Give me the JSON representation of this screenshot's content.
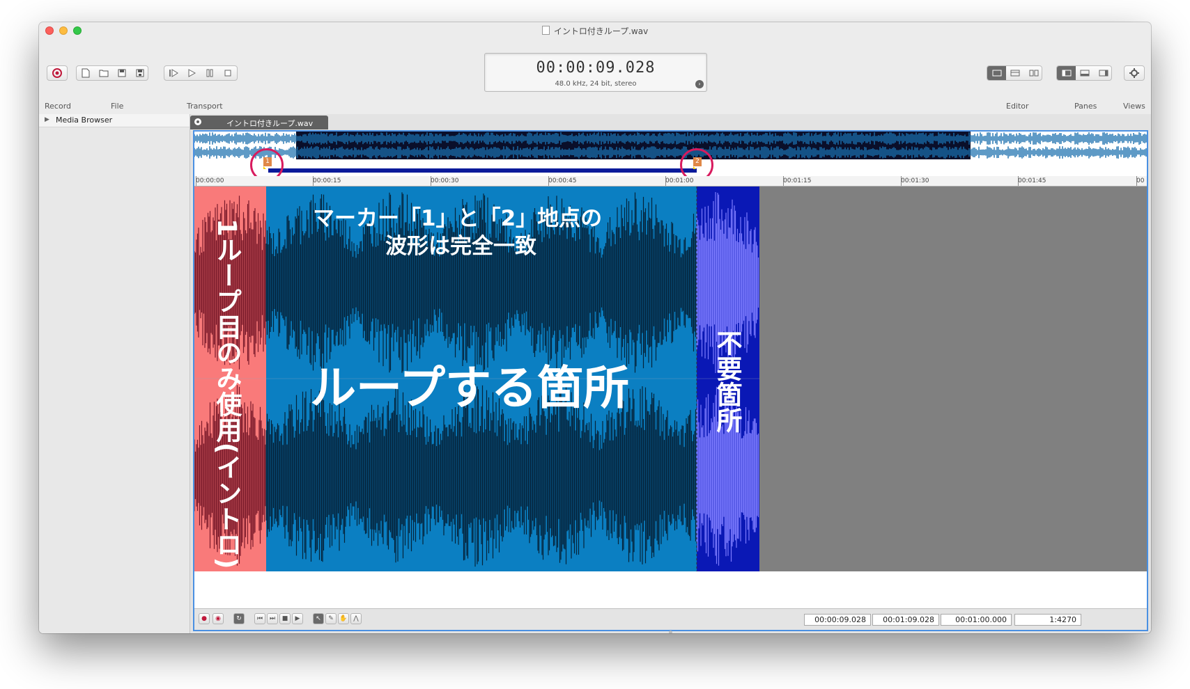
{
  "window": {
    "title": "イントロ付きループ.wav"
  },
  "toolbar": {
    "labels": {
      "record": "Record",
      "file": "File",
      "transport": "Transport",
      "editor": "Editor",
      "panes": "Panes",
      "views": "Views"
    }
  },
  "lcd": {
    "time": "00:00:09.028",
    "info": "48.0 kHz, 24 bit, stereo"
  },
  "sidebar": {
    "media_browser": "Media Browser"
  },
  "tab": {
    "label": "イントロ付きループ.wav"
  },
  "ruler": {
    "ticks": [
      "00:00:00",
      "00:00:15",
      "00:00:30",
      "00:00:45",
      "00:01:00",
      "00:01:15",
      "00:01:30",
      "00:01:45",
      "00"
    ]
  },
  "markers": [
    {
      "label": "1"
    },
    {
      "label": "2"
    }
  ],
  "annotations": {
    "marker_note_line1": "マーカー「1」と「2」地点の",
    "marker_note_line2": "波形は完全一致",
    "loop_section": "ループする箇所",
    "intro_section": "1ループ目のみ使用(イントロ)",
    "unneeded_section": "不要箇所"
  },
  "status": {
    "selection_start": "00:00:09.028",
    "selection_end": "00:01:09.028",
    "selection_length": "00:01:00.000",
    "zoom": "1:4270"
  },
  "colors": {
    "intro_bg": "#f97a7a",
    "intro_wave": "#7a1a2a",
    "loop_bg": "#0b7fc2",
    "loop_wave": "#05233a",
    "tail_bg": "#0a18b5",
    "tail_wave": "#7c7bff",
    "empty": "#808080",
    "marker_circle": "#d81b5e"
  }
}
